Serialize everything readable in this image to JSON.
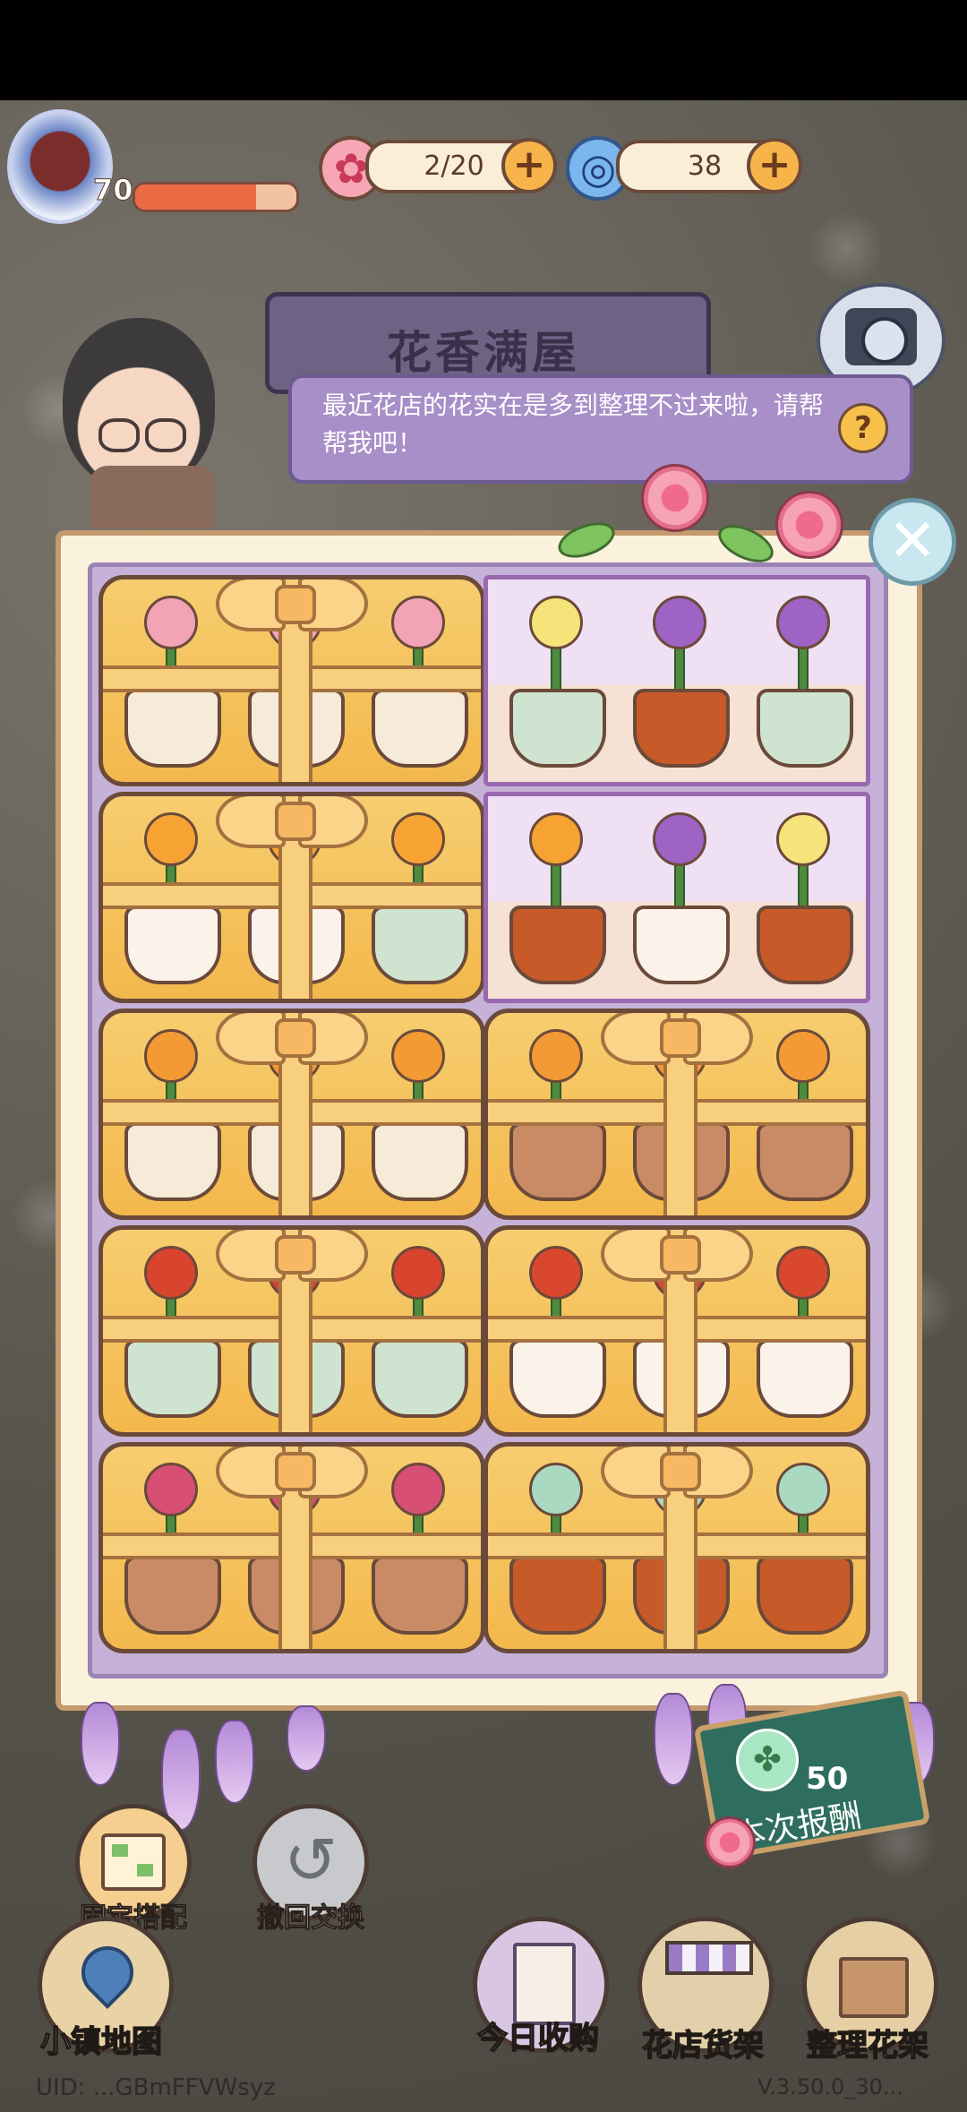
{
  "hud": {
    "level": "70",
    "level_progress": 0.75,
    "flowers": "2/20",
    "gems": "38",
    "plus": "+"
  },
  "banner": {
    "title": "花香满屋"
  },
  "dialog": {
    "text": "最近花店的花实在是多到整理不过来啦，请帮帮我吧！",
    "help": "?"
  },
  "close": "✕",
  "board": {
    "cells": [
      {
        "state": "gift",
        "plant": "carnation",
        "pots": [
          "clay-bag",
          "clay-bag",
          "clay-bag"
        ]
      },
      {
        "state": "open",
        "plants": [
          "daffodil",
          "hyacinth",
          "hyacinth"
        ],
        "pots": [
          "celadon",
          "owl",
          "celadon"
        ]
      },
      {
        "state": "gift",
        "plant": "bird-of-paradise",
        "pots": [
          "cat",
          "cat",
          "celadon"
        ]
      },
      {
        "state": "open",
        "plants": [
          "bird-of-paradise",
          "hyacinth",
          "daffodil"
        ],
        "pots": [
          "owl",
          "cat",
          "owl"
        ]
      },
      {
        "state": "gift",
        "plant": "kalanchoe",
        "pots": [
          "clay-bag",
          "clay-bag",
          "clay-bag"
        ]
      },
      {
        "state": "gift",
        "plant": "kalanchoe",
        "pots": [
          "terracotta",
          "terracotta",
          "terracotta"
        ]
      },
      {
        "state": "gift",
        "plant": "red-berry",
        "pots": [
          "celadon",
          "celadon",
          "celadon"
        ]
      },
      {
        "state": "gift",
        "plant": "bromeliad",
        "pots": [
          "cat",
          "cat",
          "cat"
        ]
      },
      {
        "state": "gift",
        "plant": "calla-lily",
        "pots": [
          "terracotta",
          "terracotta",
          "terracotta"
        ]
      },
      {
        "state": "gift",
        "plant": "succulent",
        "pots": [
          "owl",
          "owl",
          "owl"
        ]
      }
    ]
  },
  "actions": {
    "fixed": "固定搭配",
    "undo": "撤回交换"
  },
  "reward": {
    "value": "50",
    "label": "本次报酬"
  },
  "nav": {
    "map": "小镇地图",
    "purchase": "今日收购",
    "shelf": "花店货架",
    "organize": "整理花架"
  },
  "footer": {
    "uid": "UID: ...GBmFFVWsyz",
    "version": "V.3.50.0_30..."
  },
  "colors": {
    "accent": "#f6b44a",
    "bubble": "#a98fc8",
    "gift": "#f3b84c"
  }
}
